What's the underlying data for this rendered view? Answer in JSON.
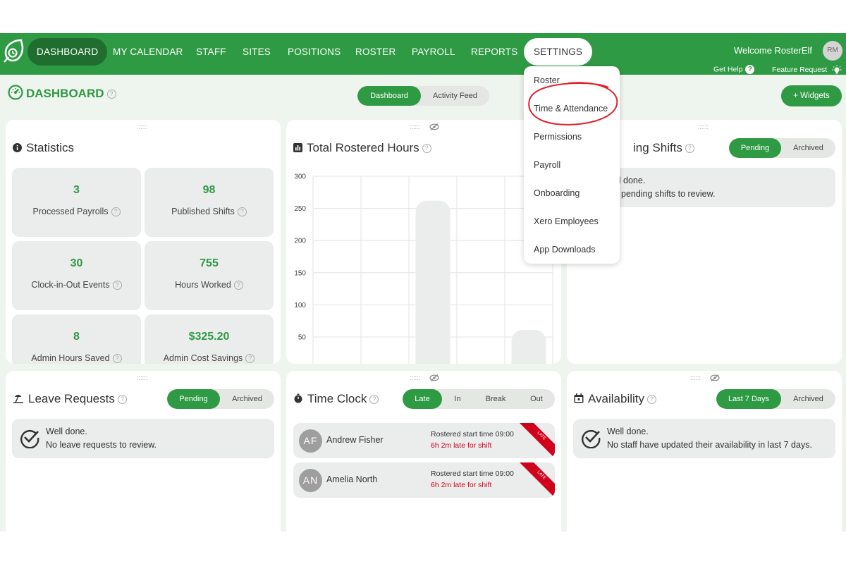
{
  "nav": {
    "items": [
      "DASHBOARD",
      "MY CALENDAR",
      "STAFF",
      "SITES",
      "POSITIONS",
      "ROSTER",
      "PAYROLL",
      "REPORTS",
      "SETTINGS"
    ],
    "welcome": "Welcome RosterElf",
    "avatar_initials": "RM",
    "get_help": "Get Help",
    "feature_request": "Feature Request"
  },
  "header": {
    "title": "DASHBOARD",
    "tabs": [
      "Dashboard",
      "Activity Feed"
    ],
    "widgets_button": "+ Widgets"
  },
  "settings_menu": {
    "items": [
      "Roster",
      "Time & Attendance",
      "Permissions",
      "Payroll",
      "Onboarding",
      "Xero Employees",
      "App Downloads"
    ]
  },
  "statistics": {
    "title": "Statistics",
    "tiles": [
      {
        "value": "3",
        "label": "Processed Payrolls"
      },
      {
        "value": "98",
        "label": "Published Shifts"
      },
      {
        "value": "30",
        "label": "Clock-in-Out Events"
      },
      {
        "value": "755",
        "label": "Hours Worked"
      },
      {
        "value": "8",
        "label": "Admin Hours Saved"
      },
      {
        "value": "$325.20",
        "label": "Admin Cost Savings"
      }
    ]
  },
  "rostered": {
    "title": "Total Rostered Hours"
  },
  "chart_data": {
    "type": "bar",
    "categories": [
      "",
      "",
      "",
      "",
      ""
    ],
    "values": [
      2,
      1,
      262,
      0,
      61
    ],
    "ylim": [
      0,
      300
    ],
    "yticks": [
      "300",
      "250",
      "200",
      "150",
      "100",
      "50"
    ],
    "grid": true,
    "bar_color": "#ebecec"
  },
  "pending_shifts": {
    "title_visible": "ing Shifts",
    "tabs": [
      "Pending",
      "Archived"
    ],
    "line1": "ll done.",
    "line2": "pending shifts to review."
  },
  "leave": {
    "title": "Leave Requests",
    "tabs": [
      "Pending",
      "Archived"
    ],
    "line1": "Well done.",
    "line2": "No leave requests to review."
  },
  "timeclock": {
    "title": "Time Clock",
    "tabs": [
      "Late",
      "In",
      "Break",
      "Out"
    ],
    "rows": [
      {
        "initials": "AF",
        "name": "Andrew Fisher",
        "rostered": "Rostered start time 09:00",
        "late": "6h 2m late for shift",
        "badge": "LATE"
      },
      {
        "initials": "AN",
        "name": "Amelia North",
        "rostered": "Rostered start time 09:00",
        "late": "6h 2m late for shift",
        "badge": "LATE"
      }
    ]
  },
  "availability": {
    "title": "Availability",
    "tabs": [
      "Last 7 Days",
      "Archived"
    ],
    "line1": "Well done.",
    "line2": "No staff have updated their availability in last 7 days."
  },
  "colors": {
    "brand_green": "#2f9a44",
    "active_nav": "#1f6e30",
    "late_red": "#d0021b",
    "annotation_red": "#e0232c"
  }
}
